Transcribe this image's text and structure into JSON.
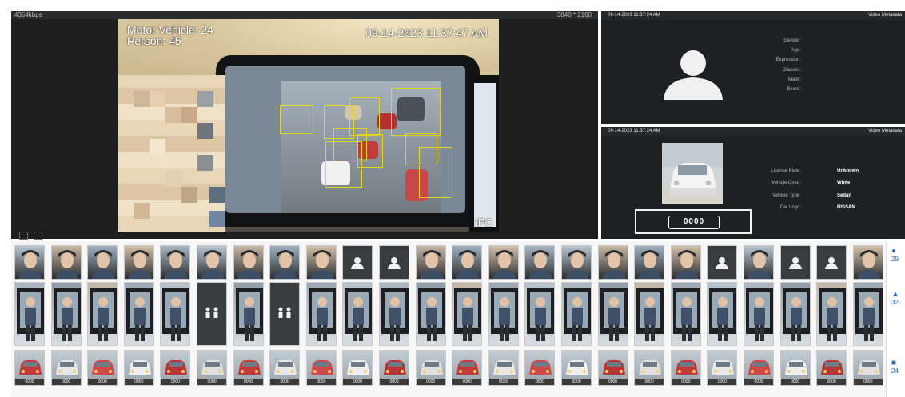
{
  "video": {
    "bitrate": "4354kbps",
    "resolution": "3840 * 2160",
    "overlay": {
      "motor_vehicle": "Motor Vehicle: 24",
      "person": "Person: 45",
      "timestamp": "09-14-2023 11:37:47 AM",
      "camera_label": "IPC"
    },
    "bottom_icons": [
      "screen-icon",
      "split-icon"
    ]
  },
  "face_panel": {
    "timestamp": "09-14-2023 11:37:24 AM",
    "title": "Video Metadata",
    "attributes": [
      {
        "key": "Gender:",
        "value": ""
      },
      {
        "key": "Age:",
        "value": ""
      },
      {
        "key": "Expression:",
        "value": ""
      },
      {
        "key": "Glasses:",
        "value": ""
      },
      {
        "key": "Mask:",
        "value": ""
      },
      {
        "key": "Beard:",
        "value": ""
      }
    ]
  },
  "vehicle_panel": {
    "timestamp": "09-14-2023 11:37:24 AM",
    "title": "Video Metadata",
    "plate_display": "0000",
    "attributes": [
      {
        "key": "License Plate:",
        "value": "Unknown"
      },
      {
        "key": "Vehicle Color:",
        "value": "White"
      },
      {
        "key": "Vehicle Type:",
        "value": "Sedan"
      },
      {
        "key": "Car Logo:",
        "value": "NISSAN"
      }
    ]
  },
  "snapshots": {
    "faces": [
      "photo",
      "photo",
      "photo",
      "photo",
      "photo",
      "photo",
      "photo",
      "photo",
      "photo",
      "person-icon",
      "person-icon",
      "photo",
      "photo",
      "photo",
      "photo",
      "photo",
      "photo",
      "photo",
      "photo",
      "person-icon",
      "photo",
      "person-icon",
      "person-icon",
      "photo"
    ],
    "bodies": [
      "photo",
      "photo",
      "photo",
      "photo",
      "photo",
      "people-icon",
      "photo",
      "people-icon",
      "photo",
      "photo",
      "photo",
      "photo",
      "photo",
      "photo",
      "photo",
      "photo",
      "photo",
      "photo",
      "photo",
      "photo",
      "photo",
      "photo",
      "photo",
      "photo"
    ],
    "vehicles": [
      {
        "plate": "0000"
      },
      {
        "plate": "0000"
      },
      {
        "plate": "0000"
      },
      {
        "plate": "0000"
      },
      {
        "plate": "0000"
      },
      {
        "plate": "0000"
      },
      {
        "plate": "0000"
      },
      {
        "plate": "0000"
      },
      {
        "plate": "0000"
      },
      {
        "plate": "0000"
      },
      {
        "plate": "0000"
      },
      {
        "plate": "0000"
      },
      {
        "plate": "0000"
      },
      {
        "plate": "0000"
      },
      {
        "plate": "0000"
      },
      {
        "plate": "0000"
      },
      {
        "plate": "0000"
      },
      {
        "plate": "0000"
      },
      {
        "plate": "0000"
      },
      {
        "plate": "0000"
      },
      {
        "plate": "0000"
      },
      {
        "plate": "0000"
      },
      {
        "plate": "0000"
      },
      {
        "plate": "0000"
      }
    ]
  },
  "stats": [
    {
      "icon": "person-icon",
      "value": "29"
    },
    {
      "icon": "people-icon",
      "value": "32"
    },
    {
      "icon": "car-icon",
      "value": "24"
    }
  ],
  "colors": {
    "accent": "#2a6fb3",
    "box": "#e7d51c",
    "panel_bg": "#1f2022"
  }
}
